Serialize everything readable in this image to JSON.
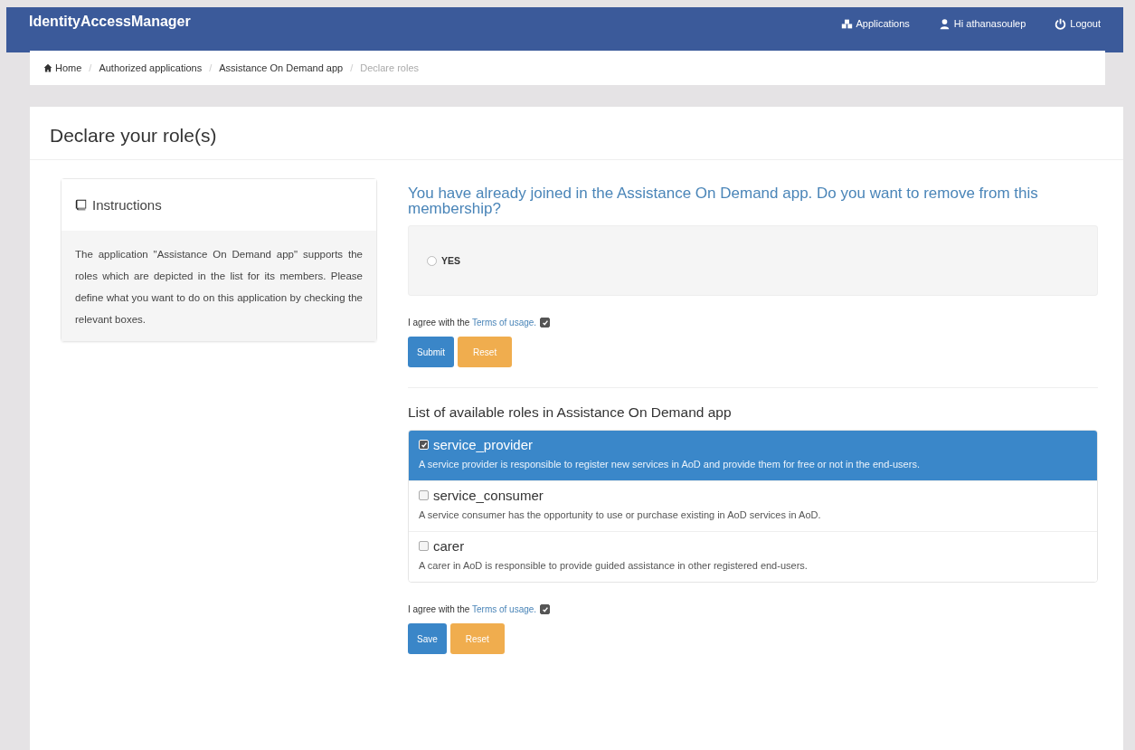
{
  "navbar": {
    "brand": "IdentityAccessManager",
    "links": [
      {
        "kind": "apps",
        "label": "Applications"
      },
      {
        "kind": "user",
        "label": "Hi athanasoulep"
      },
      {
        "kind": "power",
        "label": "Logout"
      }
    ]
  },
  "breadcrumb_separator": "/",
  "breadcrumb": [
    {
      "label": "Home",
      "kind": "home",
      "current": false
    },
    {
      "label": "Authorized applications",
      "current": false
    },
    {
      "label": "Assistance On Demand app",
      "current": false
    },
    {
      "label": "Declare roles",
      "current": true
    }
  ],
  "panel_title": "Declare your role(s)",
  "instructions": {
    "title": "Instructions",
    "text": "The application \"Assistance On Demand app\" supports the roles which are depicted in the list for its members. Please define what you want to do on this application by checking the relevant boxes."
  },
  "membership": {
    "question": "You have already joined in the Assistance On Demand app. Do you want to remove from this membership?",
    "option": {
      "label": "YES",
      "selected": false
    },
    "terms": {
      "prefix": "I agree with the ",
      "link": "Terms of usage.",
      "checked": true
    },
    "buttons": [
      {
        "label": "Submit",
        "kind": "primary"
      },
      {
        "label": "Reset",
        "kind": "warning"
      }
    ]
  },
  "roles": {
    "heading": "List of available roles in Assistance On Demand app",
    "items": [
      {
        "name": "service_provider",
        "description": "A service provider is responsible to register new services in AoD and provide them for free or not in the end-users.",
        "checked": true,
        "selected": true
      },
      {
        "name": "service_consumer",
        "description": "A service consumer has the opportunity to use or purchase existing in AoD services in AoD.",
        "checked": false,
        "selected": false
      },
      {
        "name": "carer",
        "description": "A carer in AoD is responsible to provide guided assistance in other registered end-users.",
        "checked": false,
        "selected": false
      }
    ],
    "terms": {
      "prefix": "I agree with the ",
      "link": "Terms of usage.",
      "checked": true
    },
    "buttons": [
      {
        "label": "Save",
        "kind": "primary"
      },
      {
        "label": "Reset",
        "kind": "warning"
      }
    ]
  }
}
